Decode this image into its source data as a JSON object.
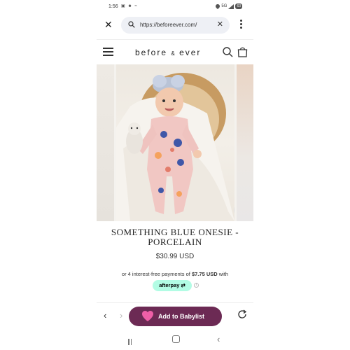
{
  "status_bar": {
    "time": "1:56",
    "icons": "▣ ☻ ≈",
    "network": "5G",
    "battery": "63"
  },
  "browser": {
    "url": "https://beforeever.com/",
    "close_icon": "close-icon",
    "clear_icon": "clear-icon",
    "menu_icon": "kebab-menu-icon"
  },
  "site": {
    "logo_part1": "before",
    "logo_amp": "&",
    "logo_part2": "ever"
  },
  "product": {
    "title": "SOMETHING BLUE ONESIE - PORCELAIN",
    "price": "$30.99 USD",
    "installments_prefix": "or 4 interest-free payments of",
    "installment_amount": "$7.75 USD",
    "installments_suffix": "with",
    "afterpay_label": "afterpay"
  },
  "babylist": {
    "button_label": "Add to Babylist",
    "back_glyph": "‹",
    "forward_glyph": "›"
  },
  "colors": {
    "babylist_purple": "#6c2a54",
    "afterpay_mint": "#b2fce4",
    "heart_pink": "#ef5fa7"
  }
}
